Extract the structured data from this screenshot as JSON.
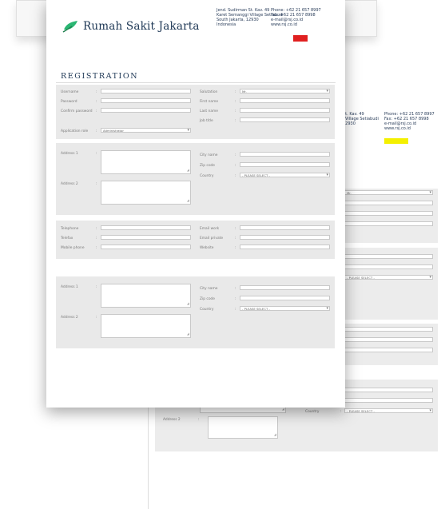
{
  "brand": {
    "name": "Rumah Sakit Jakarta"
  },
  "address_lines": "Jend. Sudirman St. Kav. 49\nKaret Semanggi Village Setiabudi\nSouth Jakarta, 12930\nIndonesia",
  "contact_lines": "Phone: +62 21 657 8997\nFax: +62 21 657 8998\ne-mail@rsj.co.id\nwww.rsj.co.id",
  "back_address_lines": "St. Kav. 49\ni Village Setiabudi\n12930",
  "back_contact_lines": "Phone: +62 21 657 8997\nFax: +62 21 657 8998\ne-mail@rsj.co.id\nwww.rsj.co.id",
  "page_title": "REGISTRATION",
  "colon": ":",
  "account": {
    "username": "Username",
    "password": "Password",
    "confirm_password": "Confirm password",
    "application_role": "Application role",
    "application_role_value": "Administrator"
  },
  "personal": {
    "salutation": "Salutation",
    "salutation_value": "Mr.",
    "first_name": "First name",
    "last_name": "Last name",
    "job_title": "Job title"
  },
  "address_block": {
    "address1": "Address 1",
    "address2": "Address 2",
    "city_name": "City name",
    "zip_code": "Zip code",
    "country": "Country",
    "country_value": "- PLEASE SELECT -"
  },
  "contact": {
    "telephone": "Telephone",
    "telefax": "Telefax",
    "mobile_phone": "Mobile phone",
    "email_work": "Email work",
    "email_private": "Email private",
    "website": "Website"
  },
  "back_page": {
    "salutation_value": "Mr.",
    "country_value": "- PLEASE SELECT -",
    "country_value_2": "- PLEASE SELECT -",
    "address2": "Address 2",
    "country": "Country"
  },
  "colors": {
    "brand_navy": "#1b3553",
    "logo_green": "#2bb673",
    "badge_red": "#e02020",
    "badge_yellow": "#f4f000",
    "panel_gray": "#e9e9e9"
  }
}
